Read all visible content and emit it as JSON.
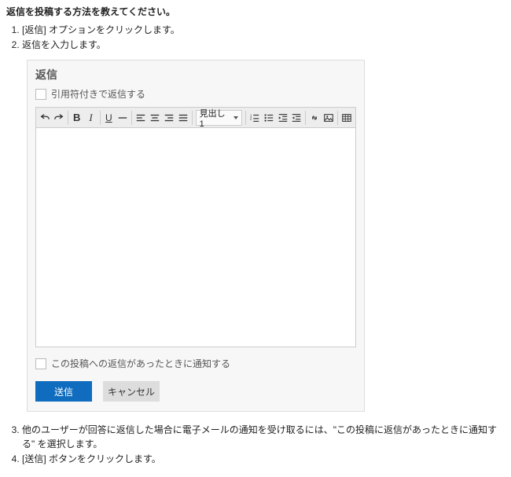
{
  "heading": "返信を投稿する方法を教えてください。",
  "steps_first": [
    "[返信] オプションをクリックします。",
    "返信を入力します。"
  ],
  "panel": {
    "title": "返信",
    "quote_checkbox_label": "引用符付きで返信する",
    "heading_select": "見出し 1",
    "notify_label": "この投稿への返信があったときに通知する",
    "submit_label": "送信",
    "cancel_label": "キャンセル"
  },
  "steps_second": [
    "他のユーザーが回答に返信した場合に電子メールの通知を受け取るには、\"この投稿に返信があったときに通知する\" を選択します。",
    "[送信] ボタンをクリックします。"
  ]
}
